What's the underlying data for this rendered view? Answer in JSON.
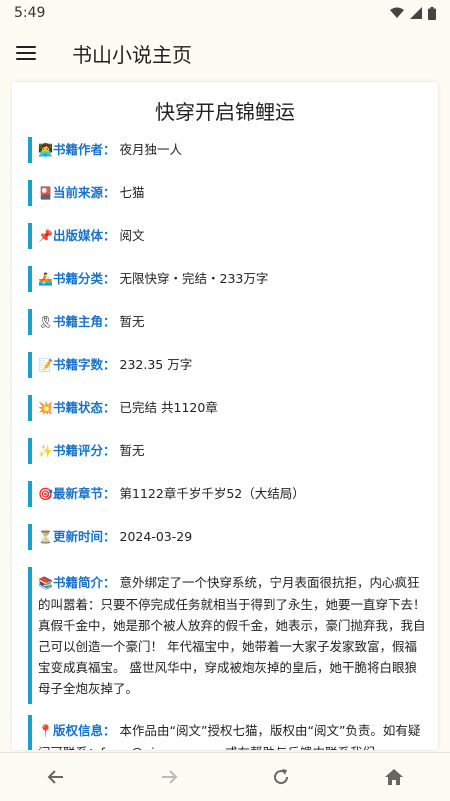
{
  "status": {
    "time": "5:49"
  },
  "appbar": {
    "title": "书山小说主页"
  },
  "book": {
    "title": "快穿开启锦鲤运",
    "fields": [
      {
        "emoji": "👩‍💻",
        "label": "书籍作者：",
        "value": "夜月独一人"
      },
      {
        "emoji": "🎴",
        "label": "当前来源：",
        "value": "七猫"
      },
      {
        "emoji": "📌",
        "label": "出版媒体：",
        "value": "阅文"
      },
      {
        "emoji": "🚣",
        "label": "书籍分类：",
        "value": "无限快穿・完结・233万字"
      },
      {
        "emoji": "🎗",
        "label": "书籍主角：",
        "value": "暂无"
      },
      {
        "emoji": "📝",
        "label": "书籍字数：",
        "value": "232.35 万字"
      },
      {
        "emoji": "💥",
        "label": "书籍状态：",
        "value": "已完结 共1120章"
      },
      {
        "emoji": "✨",
        "label": "书籍评分：",
        "value": "暂无"
      },
      {
        "emoji": "🎯",
        "label": "最新章节：",
        "value": "第1122章千岁千岁52（大结局）"
      },
      {
        "emoji": "⏳",
        "label": "更新时间：",
        "value": "2024-03-29"
      }
    ],
    "intro": {
      "emoji": "📚",
      "label": "书籍简介：",
      "value": "意外绑定了一个快穿系统，宁月表面很抗拒，内心疯狂的叫嚣着：只要不停完成任务就相当于得到了永生，她要一直穿下去！ 真假千金中，她是那个被人放弃的假千金，她表示，豪门抛弃我，我自己可以创造一个豪门！ 年代福宝中，她带着一大家子发家致富，假福宝变成真福宝。 盛世风华中，穿成被炮灰掉的皇后，她干脆将白眼狼母子全炮灰掉了。"
    },
    "copyright": {
      "emoji": "📍",
      "label": "版权信息：",
      "value": "本作品由“阅文”授权七猫，版权由“阅文”负责。如有疑问可联系：fawu@qimao.com，或在帮助与反馈中联系我们"
    }
  },
  "colors": {
    "accent": "#17a2c8",
    "label": "#1a73c9",
    "background": "#fdfcf2"
  },
  "nav": [
    "back-icon",
    "forward-icon",
    "refresh-icon",
    "home-icon"
  ]
}
